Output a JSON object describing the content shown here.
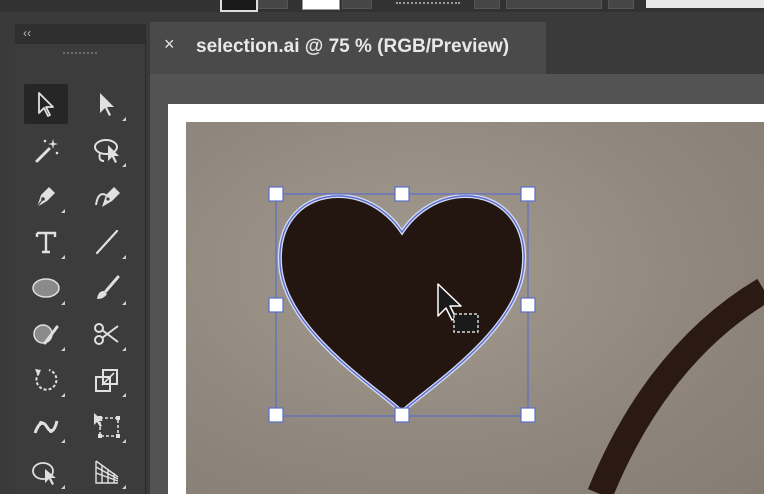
{
  "document_tab": {
    "close_label": "×",
    "title": "selection.ai @ 75 % (RGB/Preview)"
  },
  "tools_panel": {
    "collapse_label": "‹‹",
    "tools": [
      {
        "name": "selection-tool",
        "icon": "arrow-outline-icon",
        "active": true
      },
      {
        "name": "direct-selection-tool",
        "icon": "arrow-filled-icon"
      },
      {
        "name": "magic-wand-tool",
        "icon": "magic-wand-icon"
      },
      {
        "name": "lasso-tool",
        "icon": "lasso-icon"
      },
      {
        "name": "pen-tool",
        "icon": "pen-icon"
      },
      {
        "name": "curvature-tool",
        "icon": "curvature-pen-icon"
      },
      {
        "name": "type-tool",
        "icon": "type-icon",
        "label": "T"
      },
      {
        "name": "line-segment-tool",
        "icon": "line-icon"
      },
      {
        "name": "ellipse-tool",
        "icon": "ellipse-icon"
      },
      {
        "name": "paintbrush-tool",
        "icon": "paintbrush-icon"
      },
      {
        "name": "shaper-tool",
        "icon": "shaper-icon"
      },
      {
        "name": "scissors-tool",
        "icon": "scissors-icon"
      },
      {
        "name": "rotate-tool",
        "icon": "rotate-icon"
      },
      {
        "name": "scale-tool",
        "icon": "scale-icon"
      },
      {
        "name": "puppet-warp-tool",
        "icon": "puppet-warp-icon"
      },
      {
        "name": "free-transform-tool",
        "icon": "free-transform-icon"
      },
      {
        "name": "shape-builder-tool",
        "icon": "shape-builder-icon"
      },
      {
        "name": "perspective-grid-tool",
        "icon": "perspective-grid-icon"
      }
    ]
  },
  "colors": {
    "heart_fill": "#231510",
    "selection_blue": "#5b6dcc",
    "ring_stroke": "#2a1a12",
    "ui_dark": "#3c3c3c"
  }
}
